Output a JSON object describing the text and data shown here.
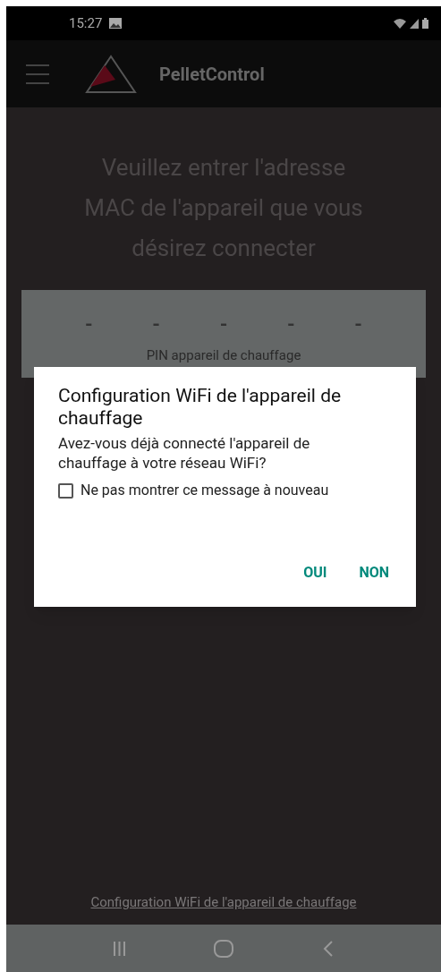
{
  "status_bar": {
    "time": "15:27"
  },
  "app_bar": {
    "title": "PelletControl"
  },
  "prompt": "Veuillez entrer l'adresse MAC de l'appareil que vous désirez connecter",
  "pin_field": {
    "digits": [
      "-",
      "-",
      "-",
      "-",
      "-"
    ],
    "label": "PIN appareil de chauffage"
  },
  "footer_link": "Configuration WiFi de l'appareil de chauffage",
  "dialog": {
    "title": "Configuration WiFi de l'appareil de chauffage",
    "message": "Avez-vous déjà connecté l'appareil de chauffage à votre réseau WiFi?",
    "checkbox": {
      "label": "Ne pas montrer ce message à nouveau",
      "checked": false
    },
    "buttons": [
      "OUI",
      "NON"
    ]
  }
}
